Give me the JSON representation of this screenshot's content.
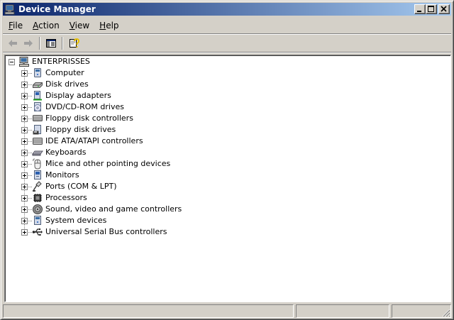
{
  "window": {
    "title": "Device Manager"
  },
  "menubar": {
    "items": [
      {
        "accel": "F",
        "rest": "ile"
      },
      {
        "accel": "A",
        "rest": "ction"
      },
      {
        "accel": "V",
        "rest": "iew"
      },
      {
        "accel": "H",
        "rest": "elp"
      }
    ]
  },
  "tree": {
    "root": "ENTERPRISSES",
    "items": [
      {
        "label": "Computer",
        "icon": "computer-icon"
      },
      {
        "label": "Disk drives",
        "icon": "disk-drive-icon"
      },
      {
        "label": "Display adapters",
        "icon": "display-adapter-icon"
      },
      {
        "label": "DVD/CD-ROM drives",
        "icon": "dvd-drive-icon"
      },
      {
        "label": "Floppy disk controllers",
        "icon": "floppy-controller-icon"
      },
      {
        "label": "Floppy disk drives",
        "icon": "floppy-drive-icon"
      },
      {
        "label": "IDE ATA/ATAPI controllers",
        "icon": "ide-controller-icon"
      },
      {
        "label": "Keyboards",
        "icon": "keyboard-icon"
      },
      {
        "label": "Mice and other pointing devices",
        "icon": "mouse-icon"
      },
      {
        "label": "Monitors",
        "icon": "monitor-icon"
      },
      {
        "label": "Ports (COM & LPT)",
        "icon": "port-icon"
      },
      {
        "label": "Processors",
        "icon": "processor-icon"
      },
      {
        "label": "Sound, video and game controllers",
        "icon": "sound-icon"
      },
      {
        "label": "System devices",
        "icon": "system-device-icon"
      },
      {
        "label": "Universal Serial Bus controllers",
        "icon": "usb-icon"
      }
    ]
  },
  "colors": {
    "titlebar_start": "#0a246a",
    "titlebar_end": "#a6caf0",
    "chrome": "#d4d0c8"
  }
}
